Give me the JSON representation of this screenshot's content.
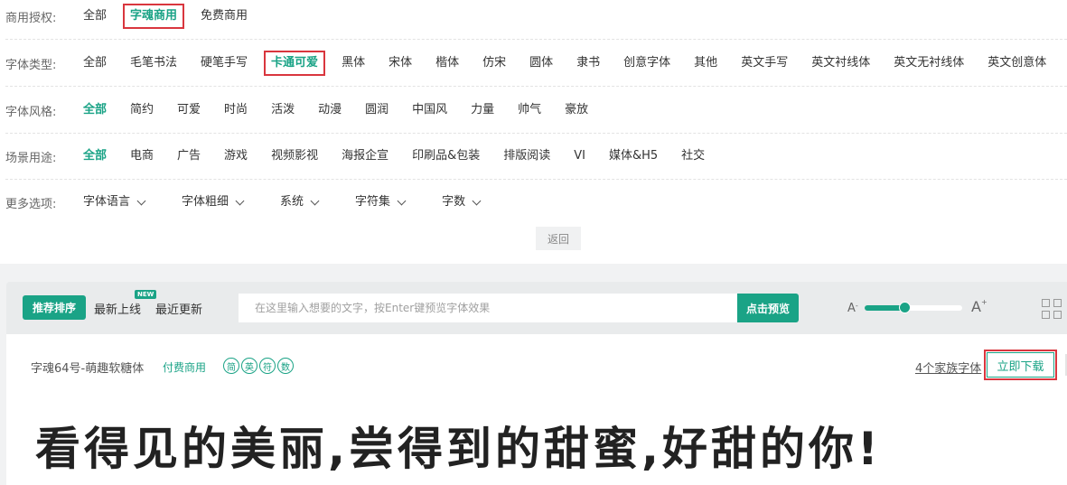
{
  "filters": {
    "license": {
      "label": "商用授权:",
      "options": [
        "全部",
        "字魂商用",
        "免费商用"
      ]
    },
    "type": {
      "label": "字体类型:",
      "options": [
        "全部",
        "毛笔书法",
        "硬笔手写",
        "卡通可爱",
        "黑体",
        "宋体",
        "楷体",
        "仿宋",
        "圆体",
        "隶书",
        "创意字体",
        "其他",
        "英文手写",
        "英文衬线体",
        "英文无衬线体",
        "英文创意体"
      ]
    },
    "style": {
      "label": "字体风格:",
      "options": [
        "全部",
        "简约",
        "可爱",
        "时尚",
        "活泼",
        "动漫",
        "圆润",
        "中国风",
        "力量",
        "帅气",
        "豪放"
      ]
    },
    "scene": {
      "label": "场景用途:",
      "options": [
        "全部",
        "电商",
        "广告",
        "游戏",
        "视频影视",
        "海报企宣",
        "印刷品&包装",
        "排版阅读",
        "VI",
        "媒体&H5",
        "社交"
      ]
    },
    "more": {
      "label": "更多选项:",
      "options": [
        "字体语言",
        "字体粗细",
        "系统",
        "字符集",
        "字数"
      ]
    }
  },
  "back_label": "返回",
  "toolbar": {
    "sort_recommended": "推荐排序",
    "sort_new": "最新上线",
    "new_badge": "NEW",
    "sort_updated": "最近更新",
    "search_placeholder": "在这里输入想要的文字，按Enter键预览字体效果",
    "preview_button": "点击预览",
    "size_small_label": "A",
    "size_small_sup": "-",
    "size_large_label": "A",
    "size_large_sup": "+",
    "size_level": 0.42
  },
  "font_card": {
    "name": "字魂64号-萌趣软糖体",
    "license": "付费商用",
    "charsets": [
      "简",
      "英",
      "符",
      "数"
    ],
    "family_link": "4个家族字体",
    "download_label": "立即下载",
    "preview_text": "看得见的美丽,尝得到的甜蜜,好甜的你!"
  },
  "accent_color": "#1aa386",
  "highlight_color": "#d9363e",
  "icons": [
    "chevron-down-icon",
    "grid-view-icon"
  ]
}
